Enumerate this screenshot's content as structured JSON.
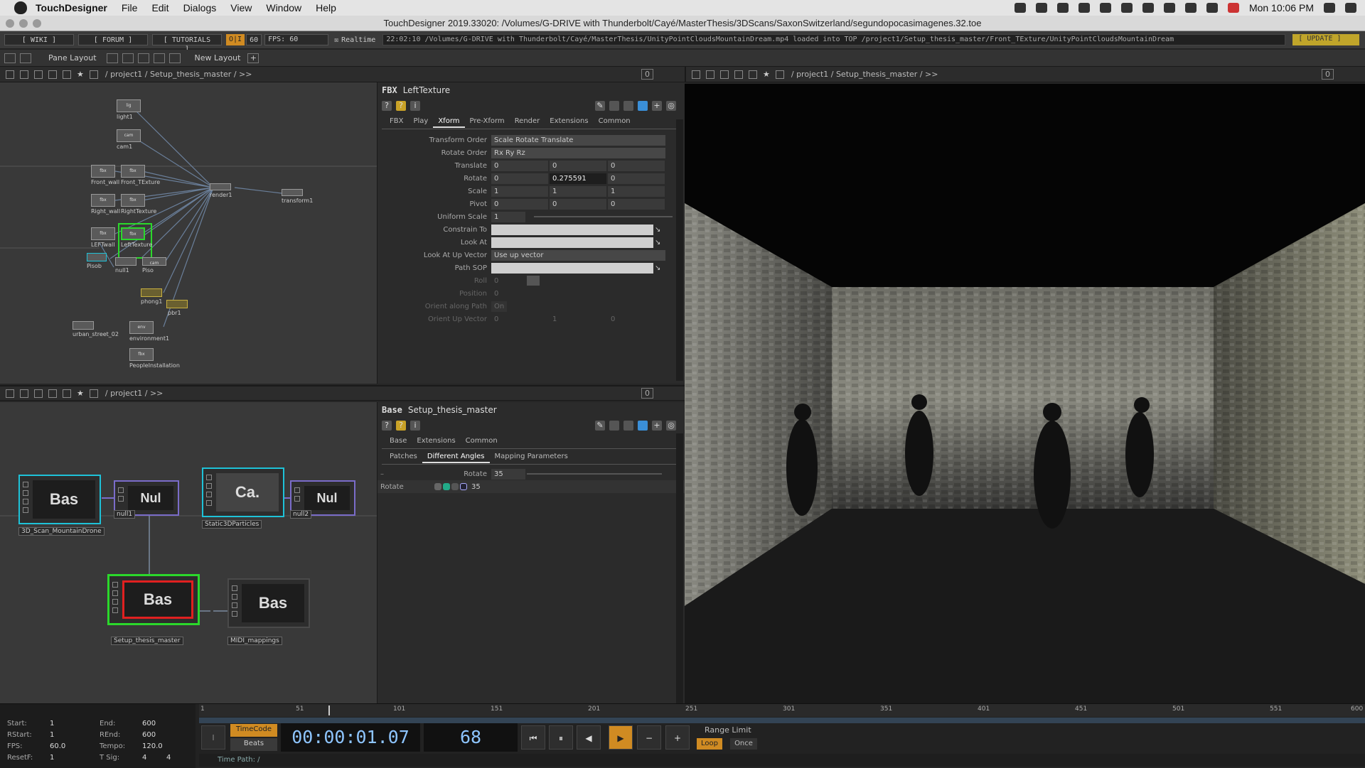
{
  "menubar": {
    "app": "TouchDesigner",
    "items": [
      "File",
      "Edit",
      "Dialogs",
      "View",
      "Window",
      "Help"
    ],
    "clock": "Mon 10:06 PM"
  },
  "window": {
    "title": "TouchDesigner 2019.33020: /Volumes/G-DRIVE with Thunderbolt/Cayé/MasterThesis/3DScans/SaxonSwitzerland/segundopocasimagenes.32.toe"
  },
  "toolbar": {
    "wiki": "[ WIKI ]",
    "forum": "[ FORUM ]",
    "tutorials": "[ TUTORIALS ]",
    "oi": "O|I",
    "fps_num": "60",
    "fps_label": "FPS:  60",
    "realtime": "Realtime",
    "status": "22:02:10 /Volumes/G-DRIVE with Thunderbolt/Cayé/MasterThesis/UnityPointCloudsMountainDream.mp4 loaded into TOP /project1/Setup_thesis_master/Front_TExture/UnityPointCloudsMountainDream",
    "update": "[ UPDATE ]"
  },
  "panebar": {
    "pane_layout": "Pane Layout",
    "new_layout": "New Layout"
  },
  "pane_tl": {
    "path": "/ project1 / Setup_thesis_master / >>",
    "zero": "0"
  },
  "pane_bl": {
    "path": "/ project1 / >>",
    "zero": "0"
  },
  "pane_r": {
    "path": "/ project1 / Setup_thesis_master / >>",
    "zero": "0"
  },
  "small_nodes": [
    {
      "label": "light1",
      "chip": "lig"
    },
    {
      "label": "cam1",
      "chip": "cam"
    },
    {
      "label": "Front_wall",
      "chip": "fbx"
    },
    {
      "label": "Front_TExture",
      "chip": "fbx"
    },
    {
      "label": "Right_wall",
      "chip": "fbx"
    },
    {
      "label": "RightTexture",
      "chip": "fbx"
    },
    {
      "label": "render1",
      "chip": ""
    },
    {
      "label": "transform1",
      "chip": ""
    },
    {
      "label": "LEFTwall",
      "chip": "fbx"
    },
    {
      "label": "LeftTexture",
      "chip": "fbx"
    },
    {
      "label": "Pisob",
      "chip": ""
    },
    {
      "label": "null1",
      "chip": ""
    },
    {
      "label": "Piso",
      "chip": "cam"
    },
    {
      "label": "phong1",
      "chip": ""
    },
    {
      "label": "pbr1",
      "chip": ""
    },
    {
      "label": "urban_street_02",
      "chip": ""
    },
    {
      "label": "environment1",
      "chip": "env"
    },
    {
      "label": "PeopleInstallation",
      "chip": "fbx"
    }
  ],
  "params_top": {
    "type": "FBX",
    "name": "LeftTexture",
    "tabs": [
      "FBX",
      "Play",
      "Xform",
      "Pre-Xform",
      "Render",
      "Extensions",
      "Common"
    ],
    "rows": [
      {
        "label": "Transform Order",
        "values": [
          "Scale Rotate Translate"
        ],
        "kind": "menu"
      },
      {
        "label": "Rotate Order",
        "values": [
          "Rx Ry Rz"
        ],
        "kind": "menu"
      },
      {
        "label": "Translate",
        "values": [
          "0",
          "0",
          "0"
        ]
      },
      {
        "label": "Rotate",
        "values": [
          "0",
          "0.275591",
          "0"
        ]
      },
      {
        "label": "Scale",
        "values": [
          "1",
          "1",
          "1"
        ]
      },
      {
        "label": "Pivot",
        "values": [
          "0",
          "0",
          "0"
        ]
      },
      {
        "label": "Uniform Scale",
        "values": [
          "1"
        ],
        "kind": "slider"
      },
      {
        "label": "Constrain To",
        "values": [
          ""
        ],
        "kind": "op"
      },
      {
        "label": "Look At",
        "values": [
          ""
        ],
        "kind": "op"
      },
      {
        "label": "Look At Up Vector",
        "values": [
          "Use up vector"
        ],
        "kind": "menu"
      },
      {
        "label": "Path SOP",
        "values": [
          ""
        ],
        "kind": "op"
      },
      {
        "label": "Roll",
        "values": [
          "0"
        ],
        "kind": "dimslider"
      },
      {
        "label": "Position",
        "values": [
          "0"
        ],
        "kind": "dimslider"
      },
      {
        "label": "Orient along Path",
        "values": [
          "On"
        ],
        "kind": "dimtoggle"
      },
      {
        "label": "Orient Up Vector",
        "values": [
          "0",
          "1",
          "0"
        ],
        "kind": "dim"
      }
    ]
  },
  "params_bottom": {
    "type": "Base",
    "name": "Setup_thesis_master",
    "tabs": [
      "Base",
      "Extensions",
      "Common"
    ],
    "subtabs": [
      "Patches",
      "Different Angles",
      "Mapping Parameters"
    ],
    "rotate_label": "Rotate",
    "rotate_value": "35"
  },
  "big_nodes": [
    {
      "chip": "Bas",
      "label": "3D_Scan_MountainDrone"
    },
    {
      "chip": "Nul",
      "label": "null1"
    },
    {
      "chip": "Ca.",
      "label": "Static3DParticles"
    },
    {
      "chip": "Nul",
      "label": "null2"
    },
    {
      "chip": "Bas",
      "label": "Setup_thesis_master"
    },
    {
      "chip": "Bas",
      "label": "MIDI_mappings"
    }
  ],
  "timeline": {
    "ticks": [
      "1",
      "51",
      "101",
      "151",
      "201",
      "251",
      "301",
      "351",
      "401",
      "451",
      "501",
      "551",
      "600"
    ],
    "start": "1",
    "end": "600",
    "rstart": "1",
    "rend": "600",
    "fps": "60.0",
    "tempo": "120.0",
    "resetf": "1",
    "tsig_a": "4",
    "tsig_b": "4",
    "labels": {
      "start": "Start:",
      "end": "End:",
      "rstart": "RStart:",
      "rend": "REnd:",
      "fps": "FPS:",
      "tempo": "Tempo:",
      "resetf": "ResetF:",
      "tsig": "T Sig:"
    },
    "timecode_btn": "TimeCode",
    "beats_btn": "Beats",
    "timecode": "00:00:01.07",
    "frame": "68",
    "range_limit": "Range Limit",
    "loop": "Loop",
    "once": "Once",
    "timepath": "Time Path: /"
  },
  "colors": {
    "accent": "#d08b22",
    "selected_green": "#2bd82b",
    "cyan": "#1ec2d8",
    "red": "#e02020"
  }
}
